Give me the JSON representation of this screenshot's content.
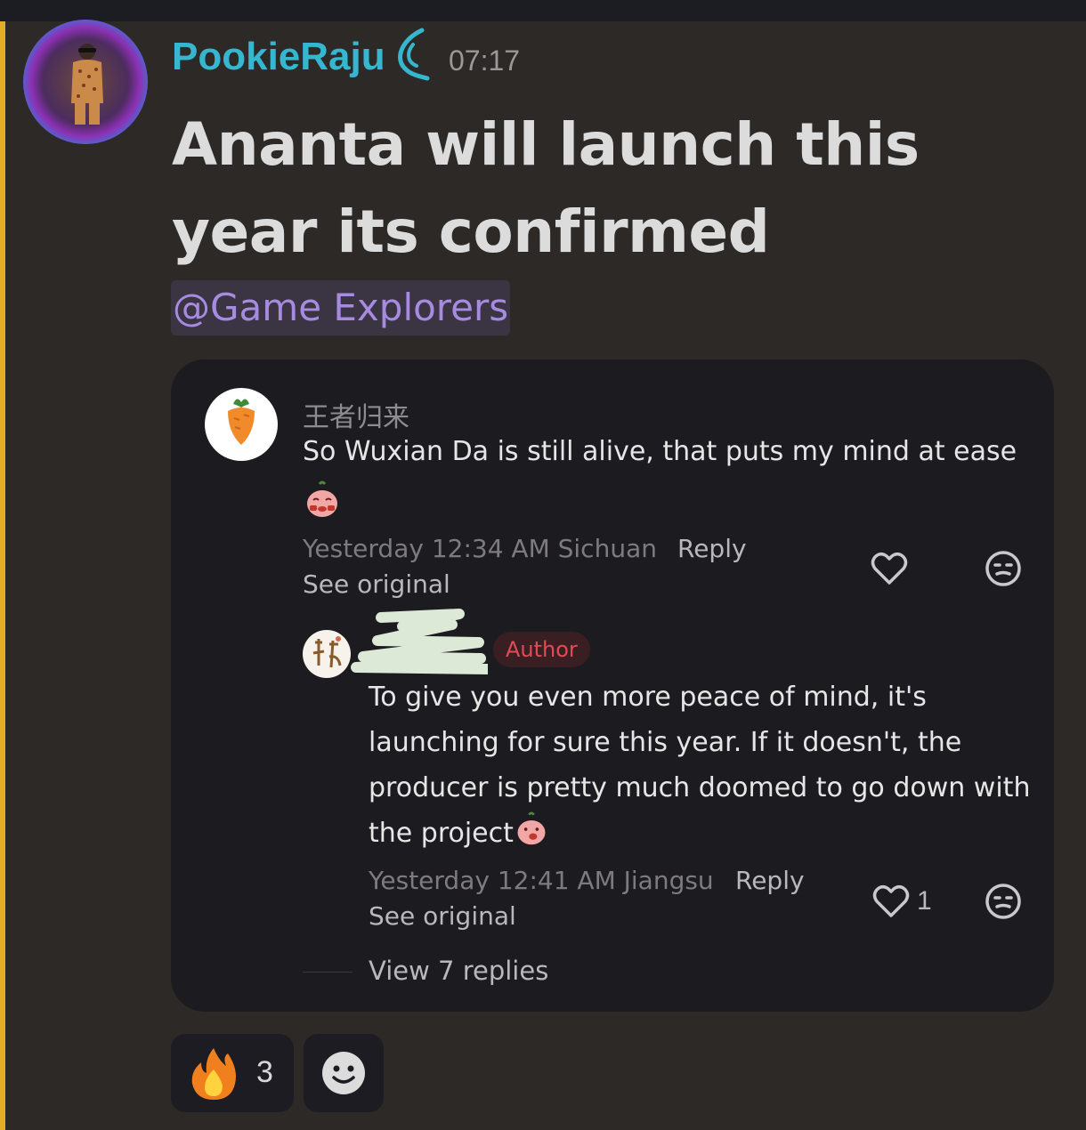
{
  "message": {
    "author": "PookieRaju",
    "author_badge_icon": "moon-swirl-icon",
    "time": "07:17",
    "text": "Ananta will launch this year its confirmed",
    "mention": "@Game Explorers",
    "colors": {
      "username": "#36b6cf",
      "mention": "#a78be0",
      "accent_bar": "#e3ad2b"
    }
  },
  "embed": {
    "comment": {
      "name": "王者归来",
      "text": "So Wuxian Da is still alive, that puts my mind at ease",
      "meta": "Yesterday 12:34 AM Sichuan",
      "reply_label": "Reply",
      "see_original": "See original"
    },
    "reply": {
      "author_badge": "Author",
      "text": "To give you even more peace of mind, it's launching for sure this year. If it doesn't, the producer is pretty much doomed to go down with the project",
      "meta": "Yesterday 12:41 AM Jiangsu",
      "reply_label": "Reply",
      "see_original": "See original",
      "like_count": "1"
    },
    "view_replies": "View 7 replies"
  },
  "reactions": [
    {
      "emoji": "fire-icon",
      "count": "3"
    }
  ]
}
